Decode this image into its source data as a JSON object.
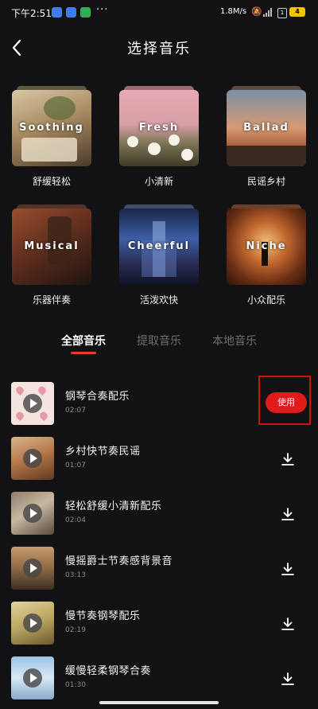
{
  "status_bar": {
    "time": "下午2:51",
    "more": "···",
    "speed": "1.8M/s",
    "sim": "1",
    "battery": "4"
  },
  "header": {
    "title": "选择音乐"
  },
  "categories": [
    {
      "en": "Soothing",
      "zh": "舒缓轻松"
    },
    {
      "en": "Fresh",
      "zh": "小清新"
    },
    {
      "en": "Ballad",
      "zh": "民谣乡村"
    },
    {
      "en": "Musical",
      "zh": "乐器伴奏"
    },
    {
      "en": "Cheerful",
      "zh": "活泼欢快"
    },
    {
      "en": "Niche",
      "zh": "小众配乐"
    }
  ],
  "tabs": [
    {
      "label": "全部音乐",
      "active": true
    },
    {
      "label": "提取音乐",
      "active": false
    },
    {
      "label": "本地音乐",
      "active": false
    }
  ],
  "tracks": [
    {
      "title": "钢琴合奏配乐",
      "duration": "02:07",
      "action": "使用"
    },
    {
      "title": "乡村快节奏民谣",
      "duration": "01:07"
    },
    {
      "title": "轻松舒缓小清新配乐",
      "duration": "02:04"
    },
    {
      "title": "慢摇爵士节奏感背景音",
      "duration": "03:13"
    },
    {
      "title": "慢节奏钢琴配乐",
      "duration": "02:19"
    },
    {
      "title": "缓慢轻柔钢琴合奏",
      "duration": "01:30"
    }
  ],
  "colors": {
    "accent": "#e01b1b",
    "background": "#121214"
  }
}
